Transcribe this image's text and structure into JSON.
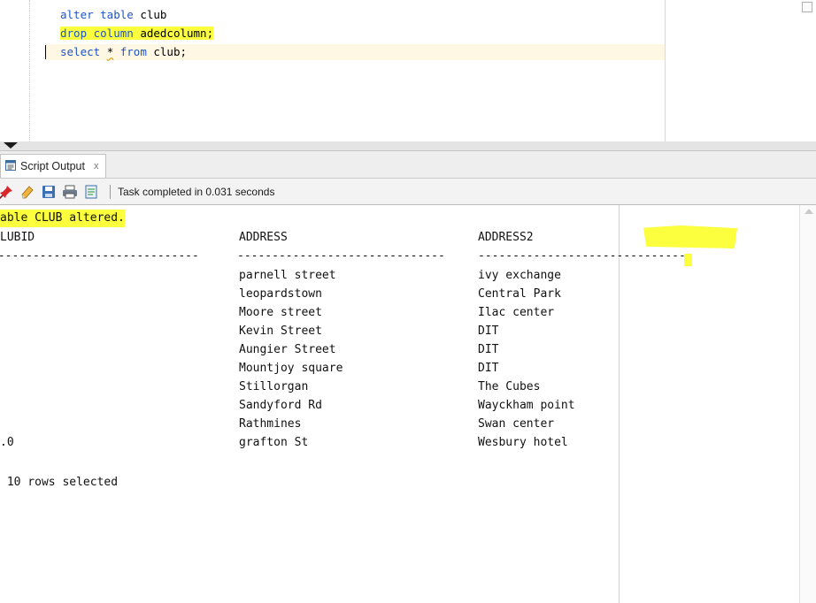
{
  "editor": {
    "lines": [
      {
        "tokens": [
          {
            "t": "alter table",
            "c": "kw"
          },
          {
            "t": " club",
            "c": ""
          }
        ]
      },
      {
        "tokens": [
          {
            "t": "drop column",
            "c": "kw"
          },
          {
            "t": " adedcolumn;",
            "c": ""
          }
        ],
        "highlighted": true
      },
      {
        "tokens": [
          {
            "t": "select",
            "c": "kw"
          },
          {
            "t": " ",
            "c": ""
          },
          {
            "t": "*",
            "c": "squiggle"
          },
          {
            "t": " ",
            "c": ""
          },
          {
            "t": "from",
            "c": "kw"
          },
          {
            "t": " club;",
            "c": ""
          }
        ],
        "current": true
      }
    ]
  },
  "output_panel": {
    "tab_label": "Script Output",
    "tab_close": "x",
    "toolbar": {
      "icons": [
        "pin-icon",
        "eraser-icon",
        "save-icon",
        "print-icon",
        "open-file-icon"
      ],
      "status": "Task completed in 0.031 seconds"
    },
    "content": {
      "message": "able CLUB altered.",
      "headers": [
        "LUBID",
        "ADDRESS",
        "ADDRESS2"
      ],
      "separators": [
        "------------------------------",
        "------------------------------",
        "------------------------------"
      ],
      "rows": [
        [
          "",
          "parnell street",
          "ivy exchange"
        ],
        [
          "",
          "leopardstown",
          "Central Park"
        ],
        [
          "",
          "Moore street",
          "Ilac center"
        ],
        [
          "",
          "Kevin Street",
          "DIT"
        ],
        [
          "",
          "Aungier Street",
          "DIT"
        ],
        [
          "",
          "Mountjoy square",
          "DIT"
        ],
        [
          "",
          "Stillorgan",
          "The Cubes"
        ],
        [
          "",
          "Sandyford Rd",
          "Wayckham point"
        ],
        [
          "",
          "Rathmines",
          "Swan center"
        ],
        [
          ".0",
          "grafton St",
          "Wesbury hotel"
        ]
      ],
      "footer": " 10 rows selected"
    }
  },
  "colors": {
    "keyword": "#1f54c5",
    "highlight": "#fbff3d",
    "current_line": "#fdf7e4"
  }
}
